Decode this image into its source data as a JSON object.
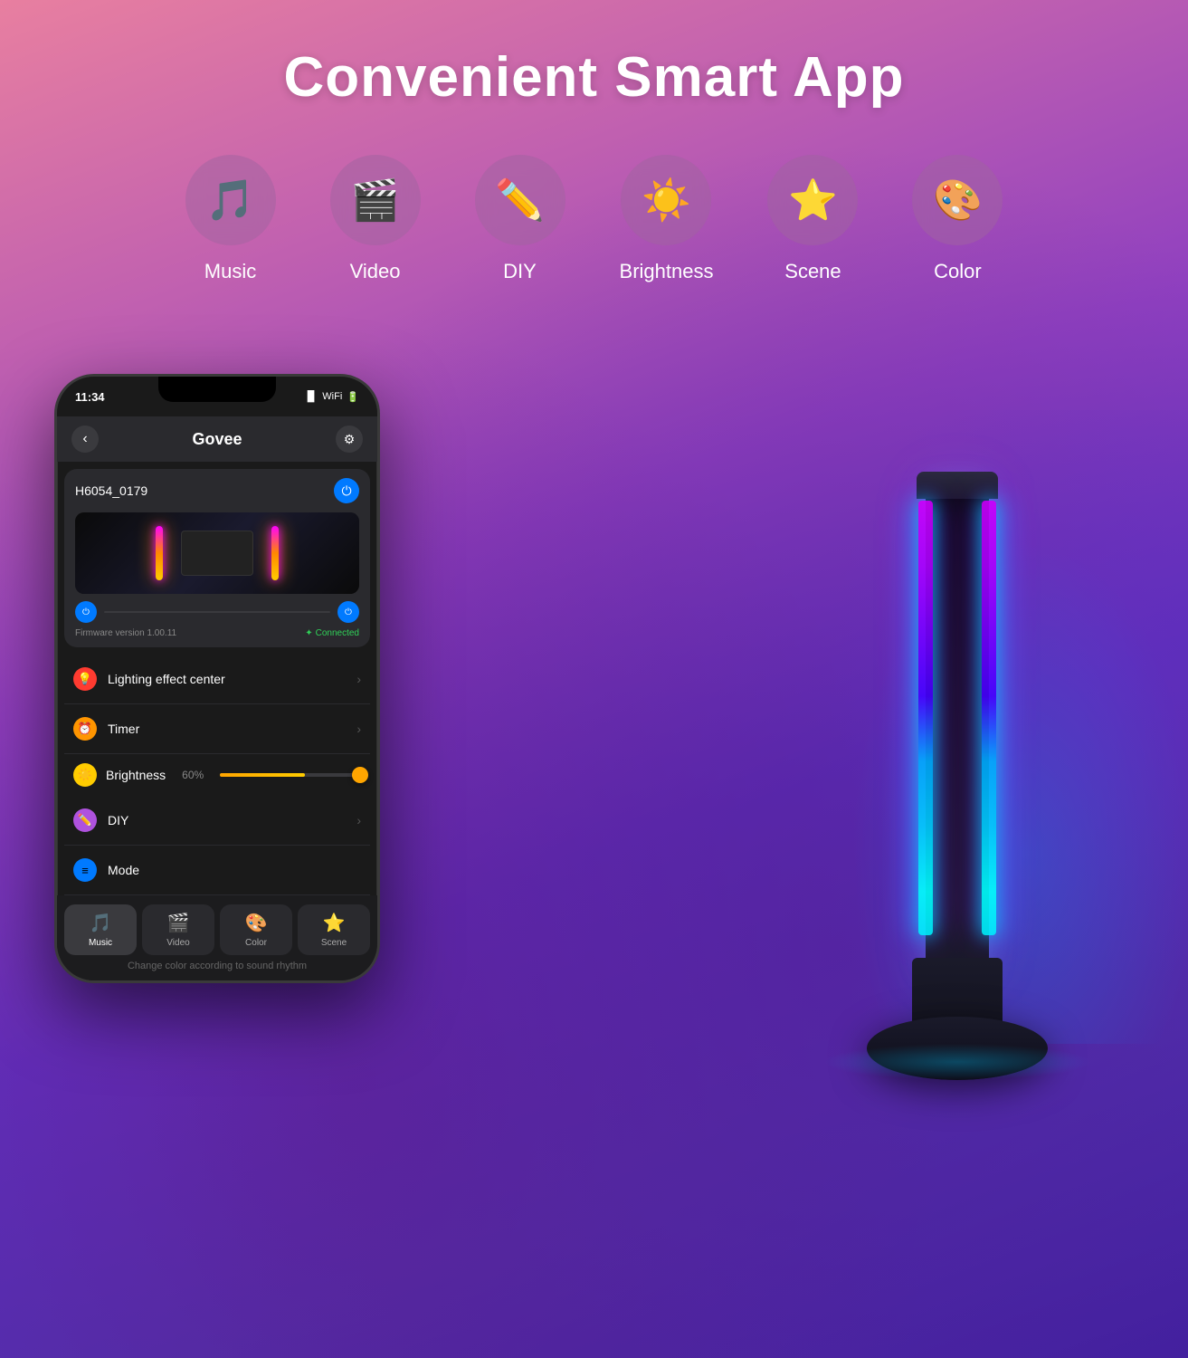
{
  "header": {
    "title": "Convenient Smart App"
  },
  "features": [
    {
      "id": "music",
      "label": "Music",
      "icon": "🎵",
      "color": "#d06080"
    },
    {
      "id": "video",
      "label": "Video",
      "icon": "🎬",
      "color": "#cc5070"
    },
    {
      "id": "diy",
      "label": "DIY",
      "icon": "✏️",
      "color": "#c05080"
    },
    {
      "id": "brightness",
      "label": "Brightness",
      "icon": "☀️",
      "color": "#a06090"
    },
    {
      "id": "scene",
      "label": "Scene",
      "icon": "⭐",
      "color": "#9060a0"
    },
    {
      "id": "color",
      "label": "Color",
      "icon": "🎨",
      "color": "#906090"
    }
  ],
  "phone": {
    "time": "11:34",
    "app_title": "Govee",
    "device_name": "H6054_0179",
    "firmware": "Firmware version 1.00.11",
    "connected": "Connected",
    "brightness_label": "Brightness",
    "brightness_value": "60%",
    "slider_percent": 60,
    "menu_items": [
      {
        "id": "lighting",
        "label": "Lighting effect center",
        "icon": "💡",
        "icon_bg": "red",
        "has_chevron": true
      },
      {
        "id": "timer",
        "label": "Timer",
        "icon": "⏰",
        "icon_bg": "orange",
        "has_chevron": true
      },
      {
        "id": "diy",
        "label": "DIY",
        "icon": "✏️",
        "icon_bg": "purple",
        "has_chevron": true
      },
      {
        "id": "mode",
        "label": "Mode",
        "icon": "≡",
        "icon_bg": "blue",
        "has_chevron": false
      }
    ],
    "tabs": [
      {
        "id": "music",
        "label": "Music",
        "icon": "🎵",
        "active": true
      },
      {
        "id": "video",
        "label": "Video",
        "icon": "🎬",
        "active": false
      },
      {
        "id": "color",
        "label": "Color",
        "icon": "🎨",
        "active": false
      },
      {
        "id": "scene",
        "label": "Scene",
        "icon": "⭐",
        "active": false
      }
    ],
    "caption": "Change color according to sound rhythm"
  },
  "colors": {
    "accent_blue": "#007aff",
    "accent_green": "#30d158",
    "accent_orange": "#ff9500",
    "brand_bg_start": "#e87fa0",
    "brand_bg_end": "#4020a0"
  }
}
